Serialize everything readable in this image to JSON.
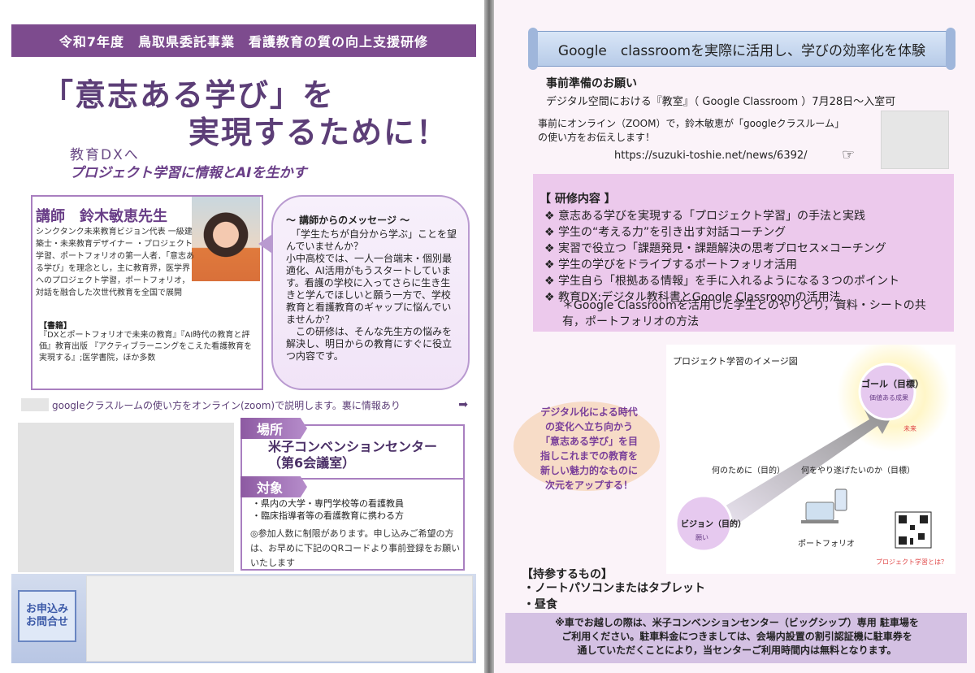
{
  "left_page": {
    "banner": "令和7年度　鳥取県委託事業　看護教育の質の向上支援研修",
    "headline_line1": "「意志ある学び」を",
    "headline_line2": "実現するために！",
    "subhead_line1": "教育DXへ",
    "subhead_line2": "プロジェクト学習に情報とAIを生かす",
    "lecturer": {
      "title": "講師　鈴木敏恵先生",
      "bio": "シンクタンク未来教育ビジョン代表 一級建築士・未来教育デザイナー ・プロジェクト学習、ポートフォリオの第一人者．「意志ある学び」を理念とし，主に教育界，医学界へのプロジェクト学習，ポートフォリオ，対話を融合した次世代教育を全国で展開",
      "books_heading": "【書籍】",
      "books": "『DXとポートフォリオで未来の教育』『AI時代の教育と評価』教育出版 『アクティブラーニングをこえた看護教育を実現する』;医学書院，ほか多数",
      "photo_icon": "portrait-photo"
    },
    "message": {
      "title": "〜 講師からのメッセージ 〜",
      "body": "　「学生たちが自分から学ぶ」ことを望んでいませんか？\n小中高校では、一人一台端末・個別最適化、AI活用がもうスタートしています。看護の学校に入ってさらに生き生きと学んでほしいと願う一方で、学校教育と看護教育のギャップに悩んでいませんか？\n　この研修は、そんな先生方の悩みを解決し、明日からの教育にすぐに役立つ内容です。"
    },
    "google_line": "googleクラスルームの使い方をオンライン(zoom)で説明します。裏に情報あり",
    "arrow_icon": "right-arrow-icon",
    "venue_label": "場所",
    "venue_name": "米子コンベンションセンター\n（第6会議室）",
    "target_label": "対象",
    "target_items": [
      "・県内の大学・専門学校等の看護教員",
      "・臨床指導者等の看護教育に携わる方"
    ],
    "target_note": "◎参加人数に制限があります。申し込みご希望の方は、お早めに下記のQRコードより事前登録をお願いいたします",
    "apply_label": "お申込み\nお問合せ"
  },
  "right_page": {
    "ribbon_title": "Google　classroomを実際に活用し、学びの効率化を体験",
    "prep_title": "事前準備のお願い",
    "prep_line": "デジタル空間における『教室』（ Google Classroom ）7月28日～入室可",
    "prep_zoom": "事前にオンライン（ZOOM）で，鈴木敏恵が「googleクラスルーム」　　　　　　の使い方をお伝えします！",
    "prep_url": "https://suzuki-toshie.net/news/6392/",
    "hand_icon": "pointing-hand-icon",
    "content_title": "【 研修内容 】",
    "content_items": [
      "❖ 意志ある学びを実現する「プロジェクト学習」の手法と実践",
      "❖ 学生の“考える力”を引き出す対話コーチング",
      "❖ 実習で役立つ「課題発見・課題解決の思考プロセス×コーチング",
      "❖ 学生の学びをドライブするポートフォリオ活用",
      "❖ 学生自ら「根拠ある情報」を手に入れるようになる３つのポイント",
      "❖ 教育DX:デジタル教科書とGoogle Classroomの活用法"
    ],
    "content_sub": "＊Google Classroomを活用した学生とのやりとり，資料・シートの共有，ポートフォリオの方法",
    "diagram": {
      "title": "プロジェクト学習のイメージ図",
      "goal": "ゴール（目標）",
      "goal_sub": "価値ある成果",
      "future": "未来",
      "vision": "ビジョン（目的）",
      "vision_sub": "願い",
      "arrow_text": "Project Based Learning",
      "why_label": "何のために（目的）",
      "what_label": "何をやり遂げたいのか（目標）",
      "portfolio": "ポートフォリオ",
      "pbl_link": "プロジェクト学習とは？",
      "qr_icon": "qr-code-icon",
      "laptop_icon": "laptop-icon",
      "phone_icon": "smartphone-icon"
    },
    "orange_text": "デジタル化による時代\nの変化へ立ち向かう\n「意志ある学び」を目\n指しこれまでの教育を\n新しい魅力的なものに\n次元をアップする！",
    "bring_title": "【持参するもの】",
    "bring_items": [
      "・ノートパソコンまたはタブレット",
      "・昼食"
    ],
    "footer": "※車でお越しの際は、米子コンベンションセンター（ビッグシップ）専用 駐車場を\nご利用ください。駐車料金につきましては、会場内設置の割引認証機に駐車券を\n通していただくことにより，当センターご利用時間内は無料となります。"
  },
  "colors": {
    "purple": "#7d4b8e",
    "lavender": "#ecc9ec",
    "footer_blue": "#c6d2ea"
  }
}
